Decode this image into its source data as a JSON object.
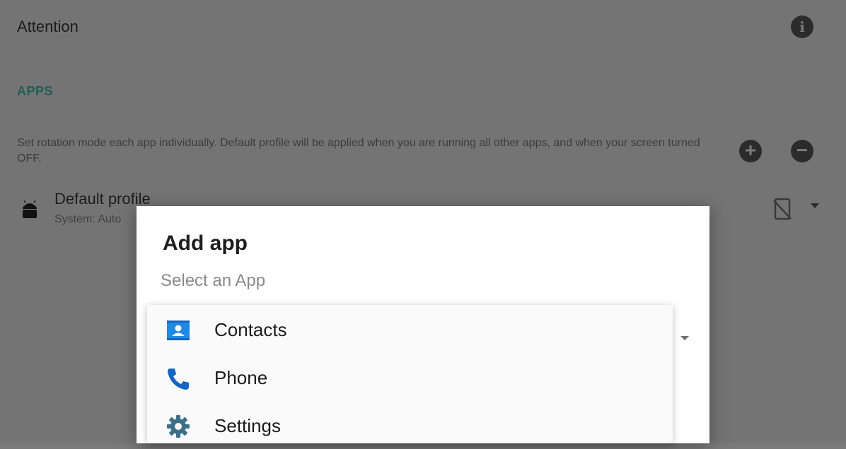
{
  "background": {
    "attention_label": "Attention",
    "info_icon": "info-icon",
    "apps_section_label": "APPS",
    "apps_description": "Set rotation mode each app individually. Default profile will be applied when you are running all other apps, and when your screen turned OFF.",
    "add_icon": "add-circle-icon",
    "remove_icon": "remove-circle-icon",
    "profile": {
      "name": "Default profile",
      "subtitle": "System: Auto",
      "icon": "android-icon",
      "mode_icon": "screen-rotation-off-icon"
    }
  },
  "dialog": {
    "title": "Add app",
    "subtitle": "Select an App"
  },
  "dropdown": {
    "items": [
      {
        "label": "Contacts",
        "icon": "contacts-icon"
      },
      {
        "label": "Phone",
        "icon": "phone-icon"
      },
      {
        "label": "Settings",
        "icon": "settings-gear-icon"
      }
    ]
  },
  "colors": {
    "accent_section": "#1f5f4f",
    "contacts_blue": "#1e88e5",
    "phone_blue": "#1565c0",
    "settings_teal": "#3d6f86",
    "scrim": "#747474"
  }
}
